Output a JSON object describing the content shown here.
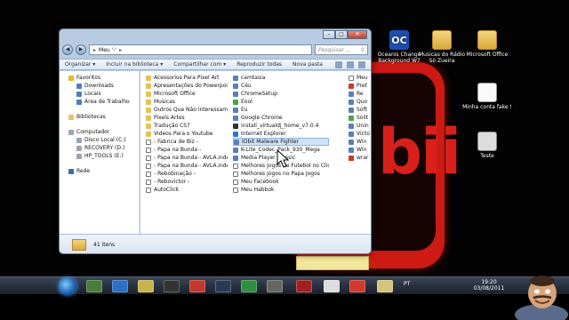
{
  "desktop": {
    "icons": [
      {
        "label": "Oceanis Change Background W7",
        "icon": "oceanis-icon",
        "glyph": "OC"
      },
      {
        "label": "Musicas do Rádio Só Zueira",
        "icon": "folder-icon"
      },
      {
        "label": "Microsoft Office",
        "icon": "folder-icon"
      },
      {
        "label": "Minha conta fake !",
        "icon": "document-icon"
      },
      {
        "label": "Teste",
        "icon": "image-icon"
      }
    ],
    "wallpaper_text": "bii"
  },
  "explorer": {
    "window_buttons": {
      "minimize": "–",
      "maximize": "□",
      "close": "✕"
    },
    "nav_back": "◀",
    "nav_forward": "▶",
    "address": [
      "Meu '-'",
      "▸"
    ],
    "address_arrow": "▸",
    "search_placeholder": "Pesquisar ...",
    "search_icon": "⚲",
    "toolbar": [
      "Organizar ▾",
      "Incluir na biblioteca ▾",
      "Compartilhar com ▾",
      "Reproduzir todas",
      "Nova pasta"
    ],
    "nav": {
      "favorites": {
        "label": "Favoritos",
        "items": [
          "Downloads",
          "Locais",
          "Área de Trabalho"
        ]
      },
      "libraries": {
        "label": "Bibliotecas"
      },
      "computer": {
        "label": "Computador",
        "items": [
          "Disco Local (C:)",
          "RECOVERY (D:)",
          "HP_TOOLS (E:)"
        ]
      },
      "network": {
        "label": "Rede"
      }
    },
    "files_col1": [
      {
        "name": "Acessorios Para Pixel Art",
        "icon": "folder"
      },
      {
        "name": "Apresentações do Powerpoint",
        "icon": "folder"
      },
      {
        "name": "Microsoft Office",
        "icon": "folder"
      },
      {
        "name": "Musicas",
        "icon": "folder"
      },
      {
        "name": "Outros Que Não interessam !",
        "icon": "folder"
      },
      {
        "name": "Pixels Artes",
        "icon": "folder"
      },
      {
        "name": "Tradução CS7",
        "icon": "folder"
      },
      {
        "name": "Videos Para o Youtube",
        "icon": "folder"
      },
      {
        "name": "- Fabrica de Biz -",
        "icon": "link"
      },
      {
        "name": "- Papa na Bunda -",
        "icon": "link"
      },
      {
        "name": "- Papa na Bunda - AVLA.index",
        "icon": "link"
      },
      {
        "name": "- Papa na Bunda - AVLA.index",
        "icon": "link"
      },
      {
        "name": "- Rebobinação -",
        "icon": "link"
      },
      {
        "name": "- Rebovictor -",
        "icon": "link"
      },
      {
        "name": "AutoClick",
        "icon": "link"
      }
    ],
    "files_col2": [
      {
        "name": "camtasia",
        "icon": "app"
      },
      {
        "name": "Céu",
        "icon": "app"
      },
      {
        "name": "ChromeSetup",
        "icon": "app"
      },
      {
        "name": "Eool",
        "icon": "green"
      },
      {
        "name": "Eu",
        "icon": "app"
      },
      {
        "name": "Google Chrome",
        "icon": "app"
      },
      {
        "name": "install_virtualdj_home_v7.0.4",
        "icon": "dark"
      },
      {
        "name": "Internet Explorer",
        "icon": "ie"
      },
      {
        "name": "IObit Malware Fighter",
        "icon": "app"
      },
      {
        "name": "K-Lite_Codec_Pack_930_Mega",
        "icon": "app"
      },
      {
        "name": "Media Player Classic",
        "icon": "app"
      },
      {
        "name": "Melhores Jogos de Futebol no Click Jogos",
        "icon": "link"
      },
      {
        "name": "Melhores Jogos no Papa Jogos",
        "icon": "link"
      },
      {
        "name": "Meu Facebook",
        "icon": "link"
      },
      {
        "name": "Meu Habbok",
        "icon": "link"
      }
    ],
    "files_col3": [
      {
        "name": "Meu",
        "icon": "link"
      },
      {
        "name": "Pret",
        "icon": "red"
      },
      {
        "name": "Re",
        "icon": "app"
      },
      {
        "name": "Quo",
        "icon": "app"
      },
      {
        "name": "Soft",
        "icon": "app"
      },
      {
        "name": "Solit",
        "icon": "green"
      },
      {
        "name": "Unin",
        "icon": "app"
      },
      {
        "name": "Victo",
        "icon": "app"
      },
      {
        "name": "Win",
        "icon": "app"
      },
      {
        "name": "Win",
        "icon": "app"
      },
      {
        "name": "wrar",
        "icon": "red"
      }
    ],
    "status": "41 itens"
  },
  "taskbar": {
    "tray_lang": "PT",
    "clock_time": "19:20",
    "clock_date": "03/08/2011"
  }
}
